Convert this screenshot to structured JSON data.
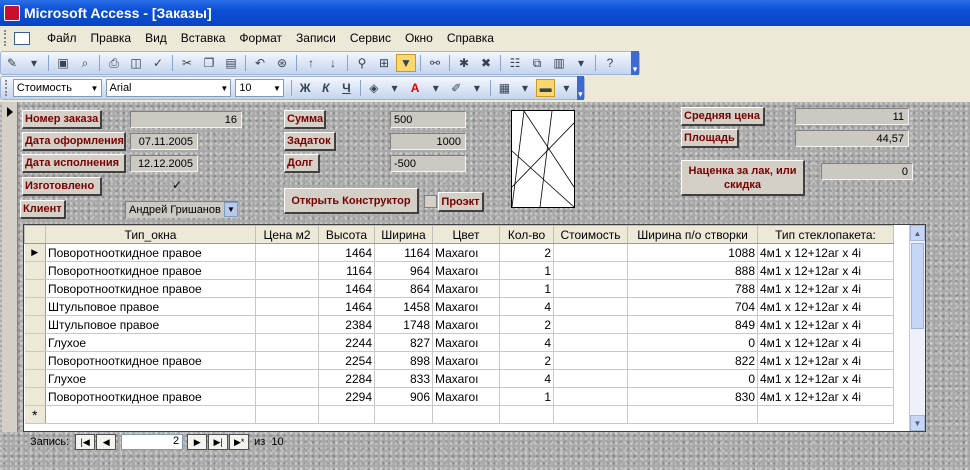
{
  "window": {
    "title": "Microsoft Access - [Заказы]"
  },
  "menu": [
    "Файл",
    "Правка",
    "Вид",
    "Вставка",
    "Формат",
    "Записи",
    "Сервис",
    "Окно",
    "Справка"
  ],
  "formatting": {
    "object_combo": "Стоимость",
    "font_combo": "Arial",
    "size_combo": "10"
  },
  "form": {
    "order_number_label": "Номер заказа",
    "order_number": "16",
    "date_issue_label": "Дата оформления",
    "date_issue": "07.11.2005",
    "date_done_label": "Дата исполнения",
    "date_done": "12.12.2005",
    "made_label": "Изготовлено",
    "made_check": "✓",
    "client_label": "Клиент",
    "client": "Андрей Гришанов",
    "sum_label": "Сумма",
    "sum": "500",
    "deposit_label": "Задаток",
    "deposit": "1000",
    "debt_label": "Долг",
    "debt": "-500",
    "open_designer_label": "Открыть Конструктор",
    "project_label": "Проэкт",
    "avg_price_label": "Средняя цена",
    "avg_price": "11",
    "area_label": "Площадь",
    "area": "44,57",
    "markup_label": "Наценка за лак, или скидка",
    "markup": "0"
  },
  "grid": {
    "columns": [
      "Тип_окна",
      "Цена м2",
      "Высота",
      "Ширина",
      "Цвет",
      "Кол-во",
      "Стоимость",
      "Ширина п/о створки",
      "Тип стеклопакета:"
    ],
    "rows": [
      [
        "Поворотнооткидное правое",
        "",
        "1464",
        "1164",
        "Махагоı",
        "2",
        "",
        "1088",
        "4м1 x 12+12аг x 4i"
      ],
      [
        "Поворотнооткидное правое",
        "",
        "1164",
        "964",
        "Махагоı",
        "1",
        "",
        "888",
        "4м1 x 12+12аг x 4i"
      ],
      [
        "Поворотнооткидное правое",
        "",
        "1464",
        "864",
        "Махагоı",
        "1",
        "",
        "788",
        "4м1 x 12+12аг x 4i"
      ],
      [
        "Штульповое правое",
        "",
        "1464",
        "1458",
        "Махагоı",
        "4",
        "",
        "704",
        "4м1 x 12+12аг x 4i"
      ],
      [
        "Штульповое правое",
        "",
        "2384",
        "1748",
        "Махагоı",
        "2",
        "",
        "849",
        "4м1 x 12+12аг x 4i"
      ],
      [
        "Глухое",
        "",
        "2244",
        "827",
        "Махагоı",
        "4",
        "",
        "0",
        "4м1 x 12+12аг x 4i"
      ],
      [
        "Поворотнооткидное правое",
        "",
        "2254",
        "898",
        "Махагоı",
        "2",
        "",
        "822",
        "4м1 x 12+12аг x 4i"
      ],
      [
        "Глухое",
        "",
        "2284",
        "833",
        "Махагоı",
        "4",
        "",
        "0",
        "4м1 x 12+12аг x 4i"
      ],
      [
        "Поворотнооткидное правое",
        "",
        "2294",
        "906",
        "Махагоı",
        "1",
        "",
        "830",
        "4м1 x 12+12аг x 4i"
      ]
    ],
    "new_row_marker": "*"
  },
  "nav": {
    "record_label": "Запись:",
    "current": "2",
    "of_label": "из",
    "total": "10"
  }
}
